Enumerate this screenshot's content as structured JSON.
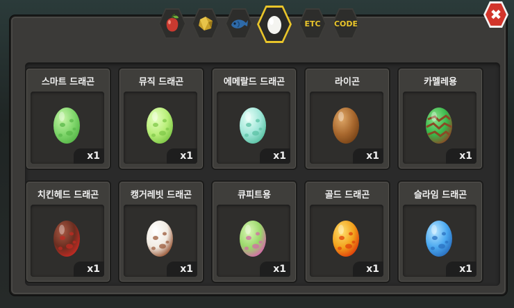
{
  "window": {
    "close_label": "✖"
  },
  "tabs": [
    {
      "name": "fruit-tab",
      "icon": "fruit-icon",
      "active": false
    },
    {
      "name": "ore-tab",
      "icon": "ore-icon",
      "active": false
    },
    {
      "name": "fish-tab",
      "icon": "fish-icon",
      "active": false
    },
    {
      "name": "egg-tab",
      "icon": "egg-icon",
      "active": true
    },
    {
      "name": "etc-tab",
      "label": "ETC",
      "active": false
    },
    {
      "name": "code-tab",
      "label": "CODE",
      "active": false
    }
  ],
  "items": [
    {
      "title": "스마트 드래곤",
      "qty": "x1",
      "egg": {
        "base": "#7fd66b",
        "light": "#c8f5a8",
        "spot": "#59b84a",
        "pattern": "spots"
      }
    },
    {
      "title": "뮤직 드래곤",
      "qty": "x1",
      "egg": {
        "base": "#b8ee78",
        "light": "#e6ffc0",
        "spot": "#7fc848",
        "pattern": "spots"
      }
    },
    {
      "title": "에메랄드 드래곤",
      "qty": "x1",
      "egg": {
        "base": "#9fe6d8",
        "light": "#e8fff8",
        "spot": "#5bc2a4",
        "pattern": "spots"
      }
    },
    {
      "title": "라이곤",
      "qty": "x1",
      "egg": {
        "base": "#a8682e",
        "light": "#e0a868",
        "spot": "#7a4518",
        "pattern": "plain"
      }
    },
    {
      "title": "카멜레용",
      "qty": "x1",
      "egg": {
        "base": "#38b84a",
        "light": "#8ee08a",
        "spot": "#8a4a26",
        "pattern": "stripes"
      }
    },
    {
      "title": "치킨헤드 드래곤",
      "qty": "x1",
      "egg": {
        "base": "#6a2d20",
        "light": "#a85a44",
        "spot": "#c22a22",
        "pattern": "spots"
      }
    },
    {
      "title": "캥거레빗 드래곤",
      "qty": "x1",
      "egg": {
        "base": "#f1ebe2",
        "light": "#ffffff",
        "spot": "#9a5a3a",
        "pattern": "spots"
      }
    },
    {
      "title": "큐피트용",
      "qty": "x1",
      "egg": {
        "base": "#9ad86a",
        "light": "#dcf7b8",
        "spot": "#d46aa8",
        "pattern": "spots"
      }
    },
    {
      "title": "골드 드래곤",
      "qty": "x1",
      "egg": {
        "base": "#f2a21c",
        "light": "#ffe070",
        "spot": "#e0400a",
        "pattern": "spots"
      }
    },
    {
      "title": "슬라임 드래곤",
      "qty": "x1",
      "egg": {
        "base": "#4aa8f0",
        "light": "#b8e6ff",
        "spot": "#2a70c0",
        "pattern": "spots"
      }
    }
  ]
}
